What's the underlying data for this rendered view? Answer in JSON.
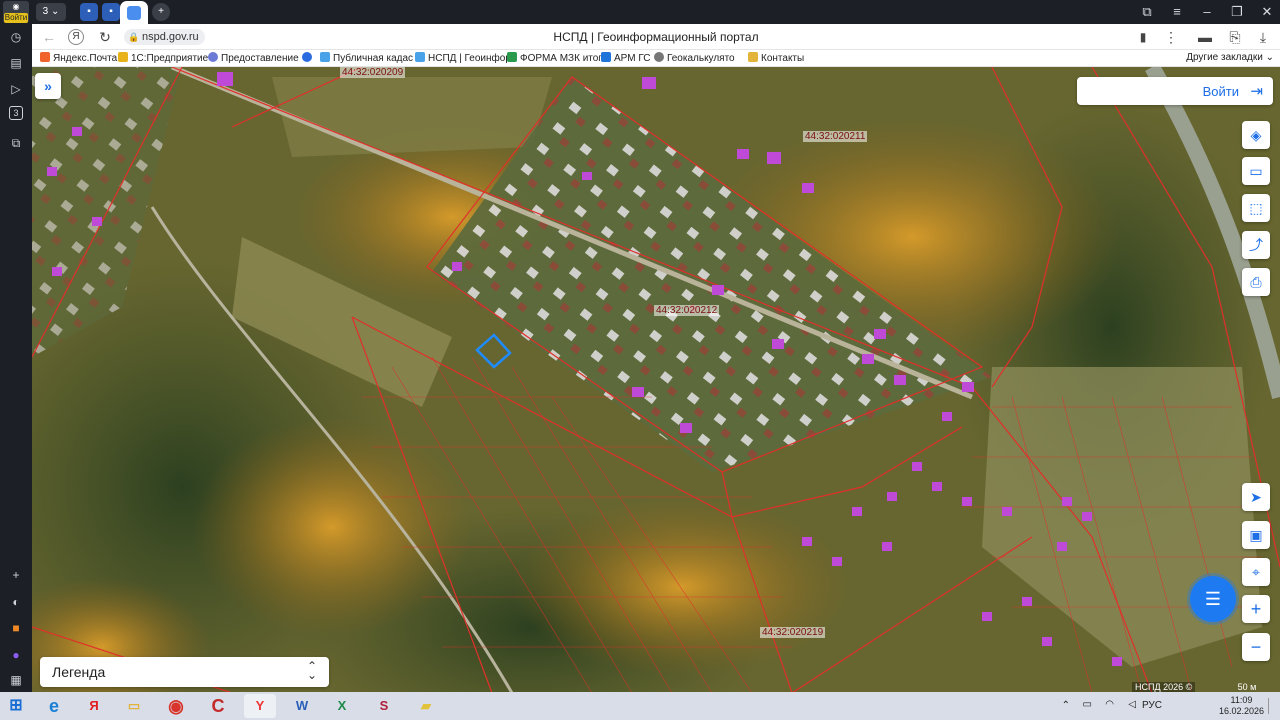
{
  "browser": {
    "user_badge": "Войти",
    "tab_badge": "3",
    "url": "nspd.gov.ru",
    "page_title": "НСПД | Геоинформационный портал",
    "rail_badge": "3"
  },
  "bookmarks": [
    {
      "label": "Яндекс.Почта",
      "color": "#f0642c"
    },
    {
      "label": "1С:Предприятие",
      "color": "#e8b21b"
    },
    {
      "label": "Предоставление",
      "color": "#6c7bd6"
    },
    {
      "label": "",
      "color": "#2a6be0"
    },
    {
      "label": "Публичная кадас",
      "color": "#4aa3e8"
    },
    {
      "label": "НСПД | Геоинфор",
      "color": "#4aa3e8"
    },
    {
      "label": "ФОРМА МЗК итог",
      "color": "#2c9a4c"
    },
    {
      "label": "АРМ ГС",
      "color": "#1e74d8"
    },
    {
      "label": "Геокалькулято",
      "color": "#777"
    },
    {
      "label": "Контакты",
      "color": "#e2b43a"
    }
  ],
  "bookmarks_other": "Другие закладки",
  "map": {
    "cadastral_labels": [
      {
        "text": "44:32:020209"
      },
      {
        "text": "44:32:020211"
      },
      {
        "text": "44:32:020212"
      },
      {
        "text": "44:32:020219"
      }
    ],
    "login_label": "Войти",
    "legend_label": "Легенда",
    "attribution": "НСПД 2026 ©",
    "scale_label": "50 м"
  },
  "taskbar": {
    "tray_lang": "РУС",
    "time": "11:09",
    "date": "16.02.2026"
  },
  "colors": {
    "accent": "#1e6ee6",
    "boundary": "#e0302a",
    "building": "#c04ad8"
  }
}
